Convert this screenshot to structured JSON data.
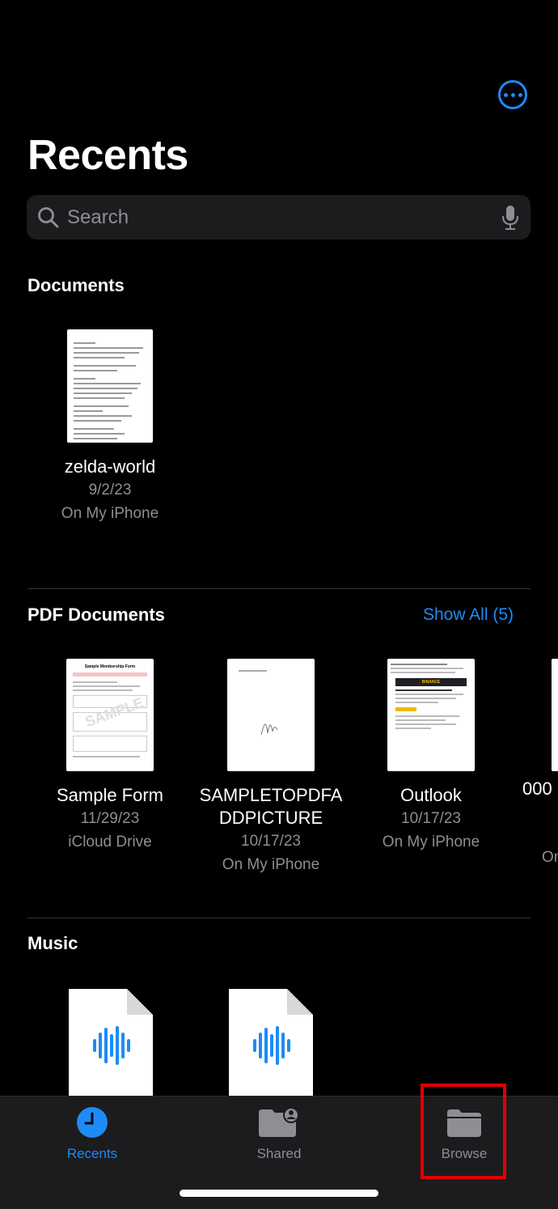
{
  "header": {
    "title": "Recents"
  },
  "search": {
    "placeholder": "Search"
  },
  "sections": {
    "documents": {
      "title": "Documents",
      "items": [
        {
          "name": "zelda-world",
          "date": "9/2/23",
          "location": "On My iPhone"
        }
      ]
    },
    "pdf": {
      "title": "PDF Documents",
      "show_all": "Show All (5)",
      "items": [
        {
          "name": "Sample Form",
          "date": "11/29/23",
          "location": "iCloud Drive",
          "thumb_title": "Sample Membership Form",
          "watermark": "SAMPLE"
        },
        {
          "name": "SAMPLETOPDFA DDPICTURE",
          "date": "10/17/23",
          "location": "On My iPhone"
        },
        {
          "name": "Outlook",
          "date": "10/17/23",
          "location": "On My iPhone",
          "brand": "BINANCE"
        },
        {
          "name": "000",
          "date": "",
          "location": "On"
        }
      ]
    },
    "music": {
      "title": "Music"
    }
  },
  "tabbar": {
    "recents": "Recents",
    "shared": "Shared",
    "browse": "Browse"
  },
  "colors": {
    "accent": "#1d8bf8",
    "highlight": "#e00000"
  }
}
